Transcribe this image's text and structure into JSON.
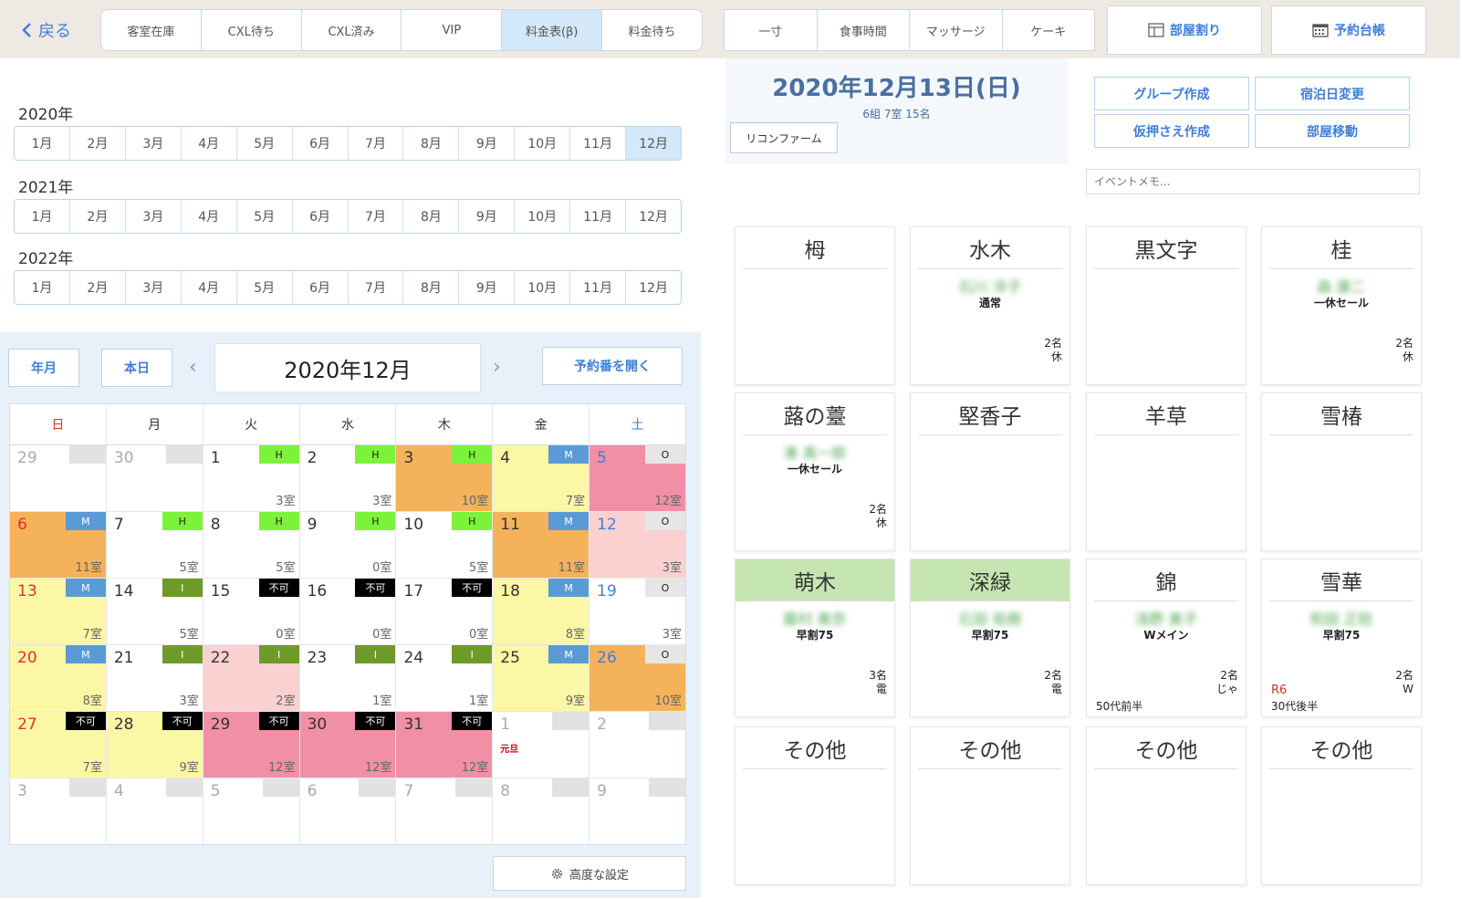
{
  "top": {
    "back_label": "戻る",
    "tabs": [
      {
        "label": "客室在庫"
      },
      {
        "label": "CXL待ち"
      },
      {
        "label": "CXL済み"
      },
      {
        "label": "VIP"
      },
      {
        "label": "料金表(β)",
        "active": true
      },
      {
        "label": "料金待ち"
      }
    ],
    "options": [
      {
        "label": "一寸"
      },
      {
        "label": "食事時間"
      },
      {
        "label": "マッサージ"
      },
      {
        "label": "ケーキ"
      }
    ],
    "room_assign_label": "部屋割り",
    "ledger_label": "予約台帳"
  },
  "years": [
    {
      "label": "2020年",
      "months": [
        "1月",
        "2月",
        "3月",
        "4月",
        "5月",
        "6月",
        "7月",
        "8月",
        "9月",
        "10月",
        "11月",
        "12月"
      ],
      "selected": 11
    },
    {
      "label": "2021年",
      "months": [
        "1月",
        "2月",
        "3月",
        "4月",
        "5月",
        "6月",
        "7月",
        "8月",
        "9月",
        "10月",
        "11月",
        "12月"
      ],
      "selected": -1
    },
    {
      "label": "2022年",
      "months": [
        "1月",
        "2月",
        "3月",
        "4月",
        "5月",
        "6月",
        "7月",
        "8月",
        "9月",
        "10月",
        "11月",
        "12月"
      ],
      "selected": -1
    }
  ],
  "calendar": {
    "year_month_btn": "年月",
    "today_btn": "本日",
    "title": "2020年12月",
    "open_booking_btn": "予約番を開く",
    "weekdays": [
      "日",
      "月",
      "火",
      "水",
      "木",
      "金",
      "土"
    ],
    "weeks": [
      [
        {
          "d": "29",
          "muted": true,
          "badge": "",
          "rooms": ""
        },
        {
          "d": "30",
          "muted": true,
          "badge": "",
          "rooms": ""
        },
        {
          "d": "1",
          "badge": "H",
          "rooms": "3室"
        },
        {
          "d": "2",
          "badge": "H",
          "rooms": "3室"
        },
        {
          "d": "3",
          "badge": "H",
          "rooms": "10室",
          "bg": "orange"
        },
        {
          "d": "4",
          "badge": "M",
          "rooms": "7室",
          "bg": "yellow"
        },
        {
          "d": "5",
          "badge": "O",
          "rooms": "12室",
          "bg": "pink"
        }
      ],
      [
        {
          "d": "6",
          "badge": "M",
          "rooms": "11室",
          "bg": "orange"
        },
        {
          "d": "7",
          "badge": "H",
          "rooms": "5室"
        },
        {
          "d": "8",
          "badge": "H",
          "rooms": "5室"
        },
        {
          "d": "9",
          "badge": "H",
          "rooms": "0室"
        },
        {
          "d": "10",
          "badge": "H",
          "rooms": "5室"
        },
        {
          "d": "11",
          "badge": "M",
          "rooms": "11室",
          "bg": "orange"
        },
        {
          "d": "12",
          "badge": "O",
          "rooms": "3室",
          "bg": "lightpink"
        }
      ],
      [
        {
          "d": "13",
          "badge": "M",
          "rooms": "7室",
          "bg": "yellow"
        },
        {
          "d": "14",
          "badge": "I",
          "rooms": "5室"
        },
        {
          "d": "15",
          "badge": "不可",
          "rooms": "0室"
        },
        {
          "d": "16",
          "badge": "不可",
          "rooms": "0室"
        },
        {
          "d": "17",
          "badge": "不可",
          "rooms": "0室"
        },
        {
          "d": "18",
          "badge": "M",
          "rooms": "8室",
          "bg": "yellow"
        },
        {
          "d": "19",
          "badge": "O",
          "rooms": "3室"
        }
      ],
      [
        {
          "d": "20",
          "badge": "M",
          "rooms": "8室",
          "bg": "yellow"
        },
        {
          "d": "21",
          "badge": "I",
          "rooms": "3室"
        },
        {
          "d": "22",
          "badge": "I",
          "rooms": "2室",
          "bg": "lightpink"
        },
        {
          "d": "23",
          "badge": "I",
          "rooms": "1室"
        },
        {
          "d": "24",
          "badge": "I",
          "rooms": "1室"
        },
        {
          "d": "25",
          "badge": "M",
          "rooms": "9室",
          "bg": "yellow"
        },
        {
          "d": "26",
          "badge": "O",
          "rooms": "10室",
          "bg": "orange"
        }
      ],
      [
        {
          "d": "27",
          "badge": "不可",
          "rooms": "7室",
          "bg": "yellow"
        },
        {
          "d": "28",
          "badge": "不可",
          "rooms": "9室",
          "bg": "yellow"
        },
        {
          "d": "29",
          "badge": "不可",
          "rooms": "12室",
          "bg": "pink"
        },
        {
          "d": "30",
          "badge": "不可",
          "rooms": "12室",
          "bg": "pink"
        },
        {
          "d": "31",
          "badge": "不可",
          "rooms": "12室",
          "bg": "pink"
        },
        {
          "d": "1",
          "muted": true,
          "badge": "",
          "rooms": "",
          "holiday": "元旦"
        },
        {
          "d": "2",
          "muted": true,
          "badge": "",
          "rooms": ""
        }
      ],
      [
        {
          "d": "3",
          "muted": true,
          "badge": "",
          "rooms": ""
        },
        {
          "d": "4",
          "muted": true,
          "badge": "",
          "rooms": ""
        },
        {
          "d": "5",
          "muted": true,
          "badge": "",
          "rooms": ""
        },
        {
          "d": "6",
          "muted": true,
          "badge": "",
          "rooms": ""
        },
        {
          "d": "7",
          "muted": true,
          "badge": "",
          "rooms": ""
        },
        {
          "d": "8",
          "muted": true,
          "badge": "",
          "rooms": ""
        },
        {
          "d": "9",
          "muted": true,
          "badge": "",
          "rooms": ""
        }
      ]
    ],
    "advanced_label": "高度な設定"
  },
  "day": {
    "title": "2020年12月13日(日)",
    "summary": "6組 7室 15名",
    "reconfirm_label": "リコンファーム",
    "actions": [
      "グループ作成",
      "宿泊日変更",
      "仮押さえ作成",
      "部屋移動"
    ],
    "memo_placeholder": "イベントメモ..."
  },
  "rooms": [
    {
      "name": "栂",
      "guest": "",
      "plan": "",
      "people": "",
      "tag": "",
      "r6": ""
    },
    {
      "name": "水木",
      "guest": "石川 洋子",
      "plan": "通常",
      "people": "2名\n休",
      "tag": "",
      "r6": ""
    },
    {
      "name": "黒文字",
      "guest": "",
      "plan": "",
      "people": "",
      "tag": "",
      "r6": ""
    },
    {
      "name": "桂",
      "guest": "森 康二",
      "plan": "一休セール",
      "people": "2名\n休",
      "tag": "",
      "r6": ""
    },
    {
      "name": "蕗の薹",
      "guest": "湊 真一郎",
      "plan": "一休セール",
      "people": "2名\n休",
      "tag": "",
      "r6": ""
    },
    {
      "name": "堅香子",
      "guest": "",
      "plan": "",
      "people": "",
      "tag": "",
      "r6": ""
    },
    {
      "name": "羊草",
      "guest": "",
      "plan": "",
      "people": "",
      "tag": "",
      "r6": ""
    },
    {
      "name": "雪椿",
      "guest": "",
      "plan": "",
      "people": "",
      "tag": "",
      "r6": ""
    },
    {
      "name": "萌木",
      "green": true,
      "guest": "藤村 美奈",
      "plan": "早割75",
      "people": "3名\n電",
      "tag": "",
      "r6": ""
    },
    {
      "name": "深緑",
      "green": true,
      "guest": "石田 祐樹",
      "plan": "早割75",
      "people": "2名\n電",
      "tag": "",
      "r6": ""
    },
    {
      "name": "錦",
      "guest": "浅野 美子",
      "plan": "Wメイン",
      "people": "2名\nじゃ",
      "tag": "50代前半",
      "r6": ""
    },
    {
      "name": "雪華",
      "guest": "和田 正稔",
      "plan": "早割75",
      "people": "2名\nW",
      "tag": "30代後半",
      "r6": "R6"
    },
    {
      "name": "その他",
      "guest": "",
      "plan": "",
      "people": "",
      "tag": "",
      "r6": ""
    },
    {
      "name": "その他",
      "guest": "",
      "plan": "",
      "people": "",
      "tag": "",
      "r6": ""
    },
    {
      "name": "その他",
      "guest": "",
      "plan": "",
      "people": "",
      "tag": "",
      "r6": ""
    },
    {
      "name": "その他",
      "guest": "",
      "plan": "",
      "people": "",
      "tag": "",
      "r6": ""
    }
  ],
  "colors": {
    "accent": "#3f7fd5",
    "orange": "#f4b25a",
    "yellow": "#fbf7a5",
    "pink": "#f18fa6",
    "lightpink": "#fbd0d0",
    "H": "#7cf33a",
    "M": "#5b9bd5",
    "I": "#6e9a2a",
    "O": "#e6e6e6",
    "不可": "#000000",
    "green_room": "#c5e6b0"
  }
}
